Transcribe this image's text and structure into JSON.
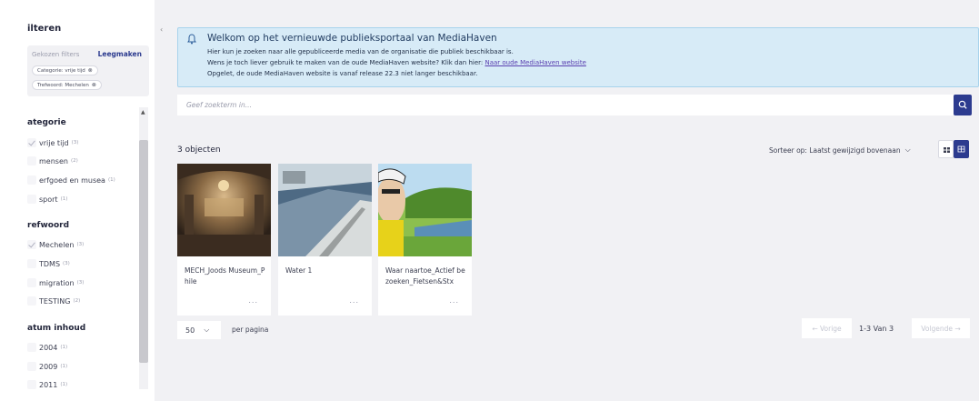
{
  "sidebar": {
    "title": "ilteren",
    "chosen_label": "Gekozen filters",
    "clear_label": "Leegmaken",
    "chips": [
      "Categorie: vrije tijd",
      "Trefwoord: Mechelen"
    ],
    "sections": [
      {
        "title": "ategorie",
        "options": [
          {
            "label": "vrije tijd",
            "count": "(3)",
            "checked": true
          },
          {
            "label": "mensen",
            "count": "(2)",
            "checked": false
          },
          {
            "label": "erfgoed en musea",
            "count": "(1)",
            "checked": false
          },
          {
            "label": "sport",
            "count": "(1)",
            "checked": false
          }
        ]
      },
      {
        "title": "refwoord",
        "options": [
          {
            "label": "Mechelen",
            "count": "(3)",
            "checked": true
          },
          {
            "label": "TDMS",
            "count": "(3)",
            "checked": false
          },
          {
            "label": "migration",
            "count": "(3)",
            "checked": false
          },
          {
            "label": "TESTING",
            "count": "(2)",
            "checked": false
          }
        ]
      },
      {
        "title": "atum inhoud",
        "options": [
          {
            "label": "2004",
            "count": "(1)",
            "checked": false
          },
          {
            "label": "2009",
            "count": "(1)",
            "checked": false
          },
          {
            "label": "2011",
            "count": "(1)",
            "checked": false
          }
        ]
      }
    ]
  },
  "banner": {
    "title": "Welkom op het vernieuwde publieksportaal van MediaHaven",
    "line1": "Hier kun je zoeken naar alle gepubliceerde media van de organisatie die publiek beschikbaar is.",
    "line2_text": "Wens je toch liever gebruik te maken van de oude MediaHaven website? Klik dan hier: ",
    "line2_link": "Naar oude MediaHaven website",
    "line3": "Opgelet, de oude MediaHaven website is vanaf release 22.3 niet langer beschikbaar."
  },
  "search": {
    "placeholder": "Geef zoekterm in..."
  },
  "results": {
    "count_label": "3 objecten",
    "sort_label": "Sorteer op: Laatst gewijzigd bovenaan"
  },
  "cards": [
    {
      "title": "MECH_Joods Museum_Phile",
      "dots": "..."
    },
    {
      "title": "Water 1",
      "dots": "..."
    },
    {
      "title": "Waar naartoe_Actief bezoeken_Fietsen&Stx",
      "dots": "..."
    }
  ],
  "pagination": {
    "per_page_value": "50",
    "per_page_label": "per pagina",
    "prev_label": "← Vorige",
    "info": "1-3 Van 3",
    "next_label": "Volgende →"
  },
  "colors": {
    "accent": "#2c3b8f",
    "banner_bg": "#d7ebf7",
    "banner_border": "#a8d3ec",
    "link": "#5a3fb0"
  }
}
